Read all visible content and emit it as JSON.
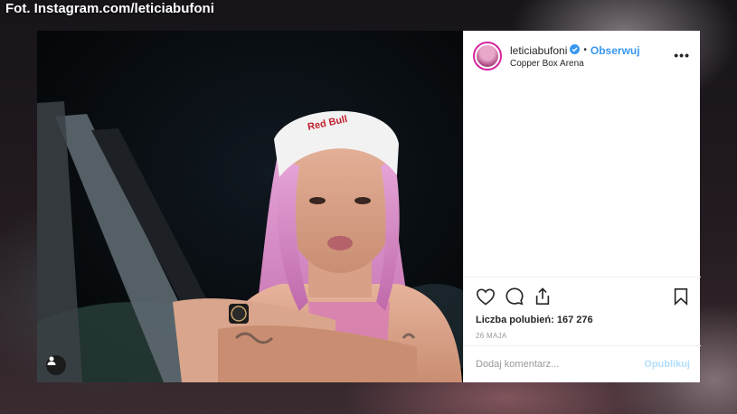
{
  "credit": "Fot. Instagram.com/leticiabufoni",
  "post": {
    "username": "leticiabufoni",
    "separator": "•",
    "follow_label": "Obserwuj",
    "location": "Copper Box Arena",
    "more_label": "•••",
    "likes_text": "Liczba polubień: 167 276",
    "date": "26 MAJA",
    "comment_placeholder": "Dodaj komentarz...",
    "publish_label": "Opublikuj",
    "headband_text": "Red Bull"
  },
  "icons": {
    "verified": "verified-badge-icon",
    "like": "heart-icon",
    "comment": "comment-icon",
    "share": "share-icon",
    "save": "bookmark-icon",
    "user_tag": "user-tag-icon"
  },
  "colors": {
    "link": "#3897f0",
    "publish_disabled": "#b2dffc",
    "text": "#262626",
    "muted": "#999999"
  }
}
